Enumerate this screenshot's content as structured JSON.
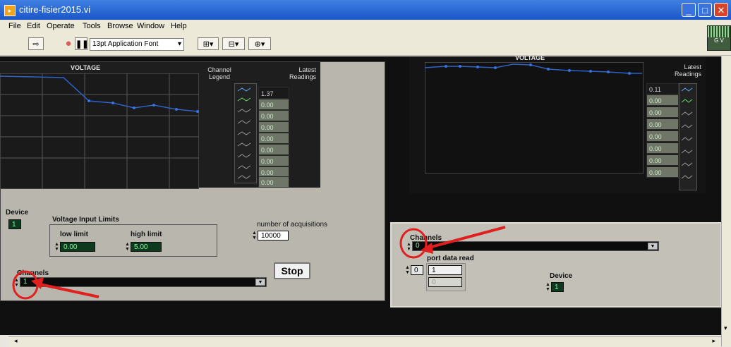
{
  "window": {
    "title": "citire-fisier2015.vi",
    "controls": [
      "_",
      "□",
      "✕"
    ]
  },
  "menu": [
    "File",
    "Edit",
    "Operate",
    "Tools",
    "Browse",
    "Window",
    "Help"
  ],
  "toolbar": {
    "font": "13pt Application Font"
  },
  "corner_icon": {
    "text": "G V"
  },
  "left_panel": {
    "graph_title": "VOLTAGE",
    "legend_label": "Channel Legend",
    "readings_label": "Latest Readings",
    "readings": [
      "1.37",
      "0.00",
      "0.00",
      "0.00",
      "0.00",
      "0.00",
      "0.00",
      "0.00",
      "0.00"
    ],
    "device_label": "Device",
    "device_value": "1",
    "limits_label": "Voltage Input Limits",
    "low_label": "low limit",
    "low_value": "0.00",
    "high_label": "high limit",
    "high_value": "5.00",
    "acq_label": "number of acquisitions",
    "acq_value": "10000",
    "channels_label": "Channels",
    "channels_value": "1",
    "stop_label": "Stop"
  },
  "right_panel": {
    "graph_title": "VOLTAGE",
    "readings_label": "Latest Readings",
    "readings": [
      "0.11",
      "0.00",
      "0.00",
      "0.00",
      "0.00",
      "0.00",
      "0.00",
      "0.00"
    ],
    "channels_label": "Channels",
    "channels_value": "0",
    "port_label": "port data read",
    "port_index": "0",
    "port_values": [
      "1",
      "0"
    ],
    "device_label": "Device",
    "device_value": "1"
  },
  "colors": {
    "accent_red": "#e01f1f",
    "graph_line": "#2f62c8",
    "led_green": "#8ff5a0"
  }
}
